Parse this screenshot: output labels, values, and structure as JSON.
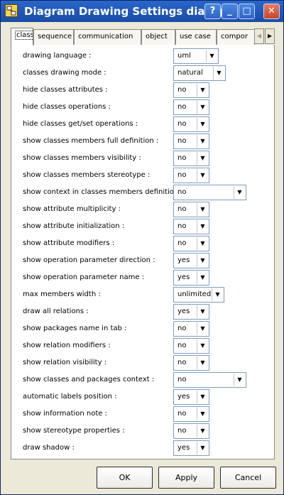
{
  "window": {
    "title": "Diagram Drawing Settings dialog",
    "help_label": "?",
    "minimize_label": "_",
    "maximize_label": "□",
    "close_label": "✕"
  },
  "tabs": [
    {
      "label": "class",
      "active": true
    },
    {
      "label": "sequence",
      "active": false
    },
    {
      "label": "communication",
      "active": false
    },
    {
      "label": "object",
      "active": false
    },
    {
      "label": "use case",
      "active": false
    },
    {
      "label": "compor",
      "active": false
    }
  ],
  "tab_scroll": {
    "left_icon": "◀",
    "right_icon": "▶"
  },
  "settings": [
    {
      "label": "drawing language :",
      "value": "uml"
    },
    {
      "label": "classes drawing mode :",
      "value": "natural"
    },
    {
      "label": "hide classes attributes :",
      "value": "no"
    },
    {
      "label": "hide classes operations :",
      "value": "no"
    },
    {
      "label": "hide classes get/set operations :",
      "value": "no"
    },
    {
      "label": "show classes members full definition :",
      "value": "no"
    },
    {
      "label": "show classes members visibility :",
      "value": "no"
    },
    {
      "label": "show classes members stereotype :",
      "value": "no"
    },
    {
      "label": "show context in classes members definition :",
      "value": "no"
    },
    {
      "label": "show attribute multiplicity :",
      "value": "no"
    },
    {
      "label": "show attribute initialization :",
      "value": "no"
    },
    {
      "label": "show attribute modifiers :",
      "value": "no"
    },
    {
      "label": "show operation parameter direction :",
      "value": "yes"
    },
    {
      "label": "show operation parameter name :",
      "value": "yes"
    },
    {
      "label": "max members width :",
      "value": "unlimited"
    },
    {
      "label": "draw all relations :",
      "value": "yes"
    },
    {
      "label": "show packages name in tab :",
      "value": "no"
    },
    {
      "label": "show relation modifiers :",
      "value": "no"
    },
    {
      "label": "show relation visibility :",
      "value": "no"
    },
    {
      "label": "show classes and packages context :",
      "value": "no"
    },
    {
      "label": "automatic labels position :",
      "value": "yes"
    },
    {
      "label": "show information note :",
      "value": "no"
    },
    {
      "label": "show stereotype properties :",
      "value": "no"
    },
    {
      "label": "draw shadow :",
      "value": "yes"
    }
  ],
  "buttons": {
    "ok": "OK",
    "apply": "Apply",
    "cancel": "Cancel"
  },
  "dropdown_arrow": "▼"
}
